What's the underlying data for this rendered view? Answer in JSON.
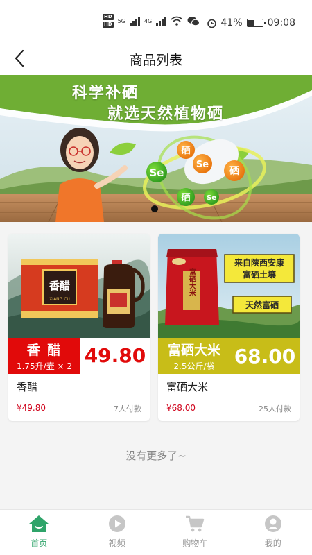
{
  "status_bar": {
    "hd1": "HD",
    "hd2": "HD",
    "net1": "5G",
    "net2": "4G",
    "battery_percent": "41%",
    "battery_level": 0.41,
    "time": "09:08"
  },
  "header": {
    "back_icon": "chevron-left-icon",
    "title": "商品列表"
  },
  "banner": {
    "line1": "科学补硒",
    "line2": "就选天然植物硒",
    "balls": [
      "硒",
      "Se",
      "Se",
      "硒",
      "硒",
      "Se"
    ],
    "active_slide": 1,
    "slide_count": 1
  },
  "products": [
    {
      "band_name": "香 醋",
      "band_spec": "1.75升/壶 × 2",
      "band_price": "49.80",
      "box_label": "香醋",
      "box_sub": "XIANG CU",
      "name": "香醋",
      "price": "¥49.80",
      "sold": "7人付款",
      "band_color": "#e10a0a"
    },
    {
      "band_name": "富硒大米",
      "band_spec": "2.5公斤/袋",
      "band_price": "68.00",
      "sign1": "来自陕西安康",
      "sign2": "富硒土壤",
      "sign3": "天然富硒",
      "bag_label": "富硒大米",
      "name": "富硒大米",
      "price": "¥68.00",
      "sold": "25人付款",
      "band_color": "#c8bd18"
    }
  ],
  "footer": {
    "no_more": "没有更多了~"
  },
  "tabs": [
    {
      "label": "首页",
      "icon": "home-icon",
      "active": true
    },
    {
      "label": "视频",
      "icon": "play-icon",
      "active": false
    },
    {
      "label": "购物车",
      "icon": "cart-icon",
      "active": false
    },
    {
      "label": "我的",
      "icon": "user-icon",
      "active": false
    }
  ],
  "colors": {
    "accent": "#2fa46a",
    "price_red": "#d0021b",
    "banner_green": "#6fae34"
  }
}
